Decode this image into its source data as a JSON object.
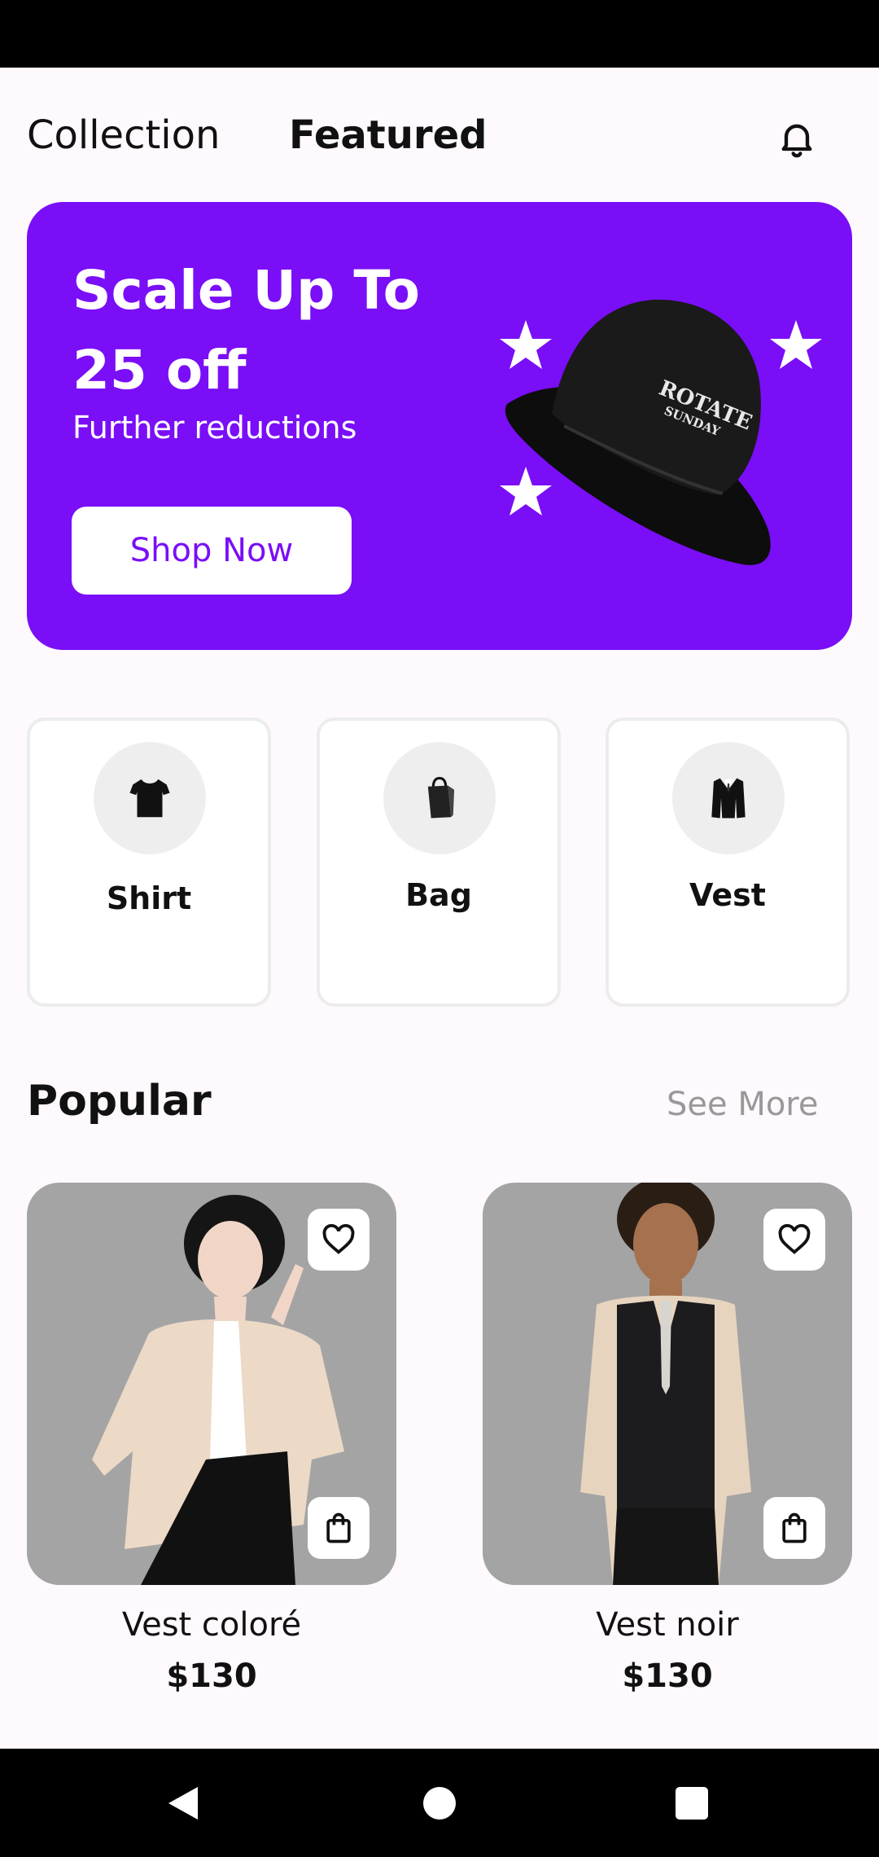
{
  "header": {
    "tabs": [
      {
        "label": "Collection",
        "active": false
      },
      {
        "label": "Featured",
        "active": true
      }
    ],
    "notification_icon": "bell-icon"
  },
  "banner": {
    "title_line1": "Scale Up To",
    "title_line2": "25 off",
    "subtitle": "Further reductions",
    "button_label": "Shop Now",
    "background_color": "#7A0EF7",
    "hat_text_line1": "ROTATE",
    "hat_text_line2": "SUNDAY"
  },
  "categories": [
    {
      "label": "Shirt",
      "icon": "tshirt-icon"
    },
    {
      "label": "Bag",
      "icon": "shopping-bag-icon"
    },
    {
      "label": "Vest",
      "icon": "suit-icon"
    }
  ],
  "popular": {
    "title": "Popular",
    "see_more": "See More",
    "products": [
      {
        "name": "Vest coloré",
        "price": "$130"
      },
      {
        "name": "Vest noir",
        "price": "$130"
      }
    ]
  },
  "system_nav": {
    "back": "back-icon",
    "home": "home-icon",
    "recents": "recents-icon"
  }
}
